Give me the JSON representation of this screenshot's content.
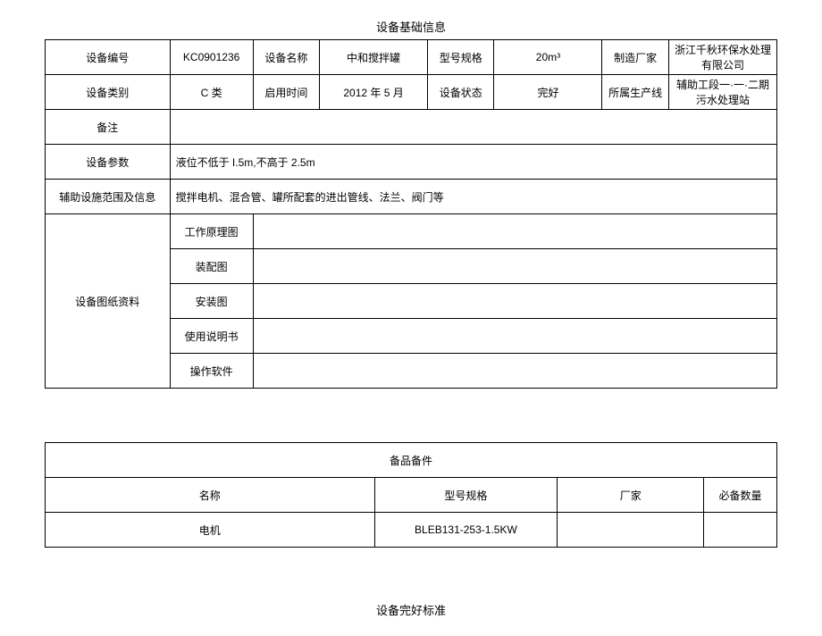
{
  "title1": "设备基础信息",
  "row1": {
    "c1": "设备编号",
    "c2": "KC0901236",
    "c3": "设备名称",
    "c4": "中和搅拌罐",
    "c5": "型号规格",
    "c6": "20m³",
    "c7": "制造厂家",
    "c8": "浙江千秋环保水处理有限公司"
  },
  "row2": {
    "c1": "设备类别",
    "c2": "C 类",
    "c3": "启用时间",
    "c4": "2012 年 5 月",
    "c5": "设备状态",
    "c6": "完好",
    "c7": "所属生产线",
    "c8": "辅助工段一·一·二期污水处理站"
  },
  "row3": {
    "c1": "备注",
    "c2": ""
  },
  "row4": {
    "c1": "设备参数",
    "c2": "液位不低于 I.5m,不高于 2.5m"
  },
  "row5": {
    "c1": "辅助设施范围及信息",
    "c2": "搅拌电机、混合管、罐所配套的进出管线、法兰、阀门等"
  },
  "row6": {
    "c1": "设备图纸资料",
    "items": [
      "工作原理图",
      "装配图",
      "安装图",
      "使用说明书",
      "操作软件"
    ]
  },
  "title2": "备品备件",
  "spare_headers": {
    "c1": "名称",
    "c2": "型号规格",
    "c3": "厂家",
    "c4": "必备数量"
  },
  "spare_row": {
    "c1": "电机",
    "c2": "BLEB131-253-1.5KW",
    "c3": "",
    "c4": ""
  },
  "title3": "设备完好标准"
}
